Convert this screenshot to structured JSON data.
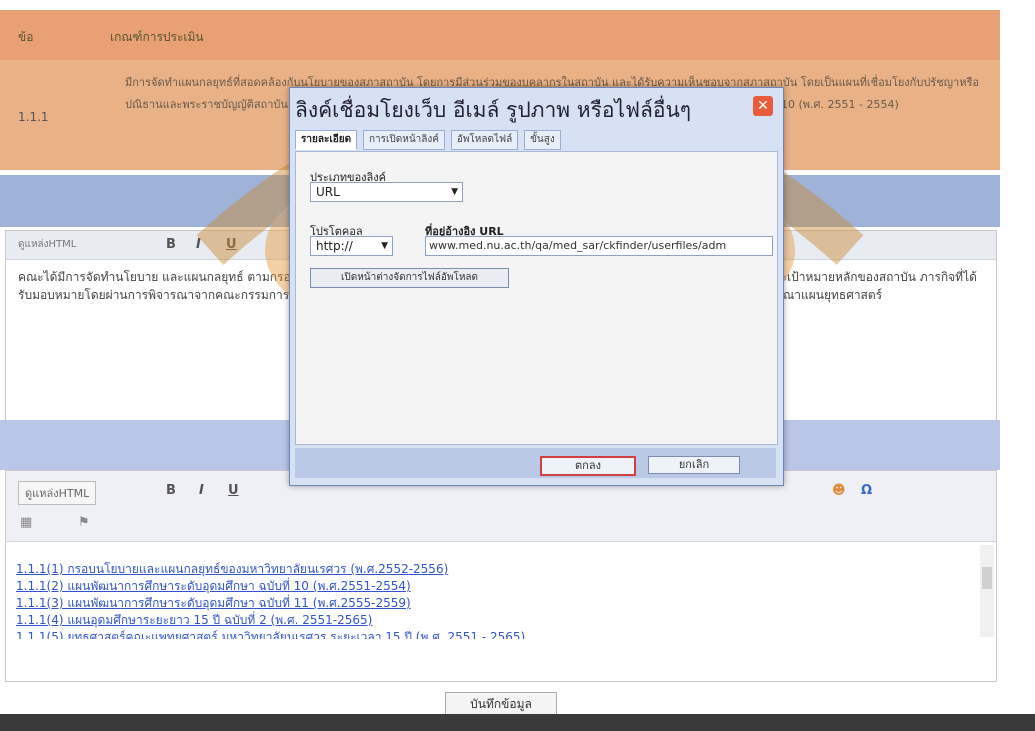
{
  "table": {
    "col_no": "ข้อ",
    "col_criteria": "เกณฑ์การประเมิน",
    "row_number": "1.1.1",
    "criteria_text": "มีการจัดทำแผนกลยุทธ์ที่สอดคล้องกับนโยบายของสภาสถาบัน โดยการมีส่วนร่วมของบุคลากรในสถาบัน และได้รับความเห็นชอบจากสภาสถาบัน โดยเป็นแผนที่เชื่อมโยงกับปรัชญาหรือปณิธานและพระราชบัญญัติสถาบัน รวมทั้งสอดคล้องกับจุดเน้นของกลุ่มสถาบัน และสอดคล้องกับแผนพัฒนาการศึกษาระดับอุดมศึกษา ฉบับที่ 10 (พ.ศ. 2551 - 2554)"
  },
  "editor1": {
    "source_label": "ดูแหล่งHTML",
    "body_text": "คณะได้มีการจัดทำนโยบาย และแผนกลยุทธ์ ตามกรอบนโยบายและแผนกลยุทธ์ของมหาวิทยาลัยนเรศวร ให้สอดคล้องกับวิสัยทัศน์ พันธกิจ นโยบายและเป้าหมายหลักของสถาบัน ภารกิจที่ได้รับมอบหมายโดยผ่านการพิจารณาจากคณะกรรมการประจำคณะ และเสนอต่อสภามหาวิทยาลัยเพื่อพิจารณาอนุมัติ และนำเสนอให้คณะกรรมการพิจารณาแผนยุทธศาสตร์"
  },
  "editor2": {
    "source_label": "ดูแหล่งHTML",
    "links": [
      "1.1.1(1) กรอบนโยบายและแผนกลยุทธ์ของมหาวิทยาลัยนเรศวร (พ.ศ.2552-2556)",
      "1.1.1(2) แผนพัฒนาการศึกษาระดับอุดมศึกษา ฉบับที่ 10 (พ.ศ.2551-2554)",
      "1.1.1(3) แผนพัฒนาการศึกษาระดับอุดมศึกษา ฉบับที่ 11 (พ.ศ.2555-2559)",
      "1.1.1(4) แผนอุดมศึกษาระยะยาว 15 ปี ฉบับที่ 2 (พ.ศ. 2551-2565)",
      "1.1.1(5) ยุทธศาสตร์คณะแพทยศาสตร์ มหาวิทยาลัยนเรศวร ระยะเวลา 15 ปี (พ.ศ. 2551 - 2565)"
    ]
  },
  "save_label": "บันทึกข้อมูล",
  "dialog": {
    "title": "ลิงค์เชื่อมโยงเว็บ อีเมล์ รูปภาพ หรือไฟล์อื่นๆ",
    "close": "✕",
    "tabs": [
      "รายละเอียด",
      "การเปิดหน้าลิงค์",
      "อัพโหลดไฟล์",
      "ขั้นสูง"
    ],
    "link_type_label": "ประเภทของลิงค์",
    "link_type_value": "URL",
    "protocol_label": "โปรโตคอล",
    "protocol_value": "http://",
    "url_label": "ที่อยู่อ้างอิง URL",
    "url_value": "www.med.nu.ac.th/qa/med_sar/ckfinder/userfiles/adm",
    "browse_button": "เปิดหน้าต่างจัดการไฟล์อัพโหลด",
    "ok_button": "ตกลง",
    "cancel_button": "ยกเลิก"
  },
  "colors": {
    "header_orange": "#e8a074",
    "dialog_bg": "#d6e2f4",
    "ok_border": "#d04040"
  }
}
